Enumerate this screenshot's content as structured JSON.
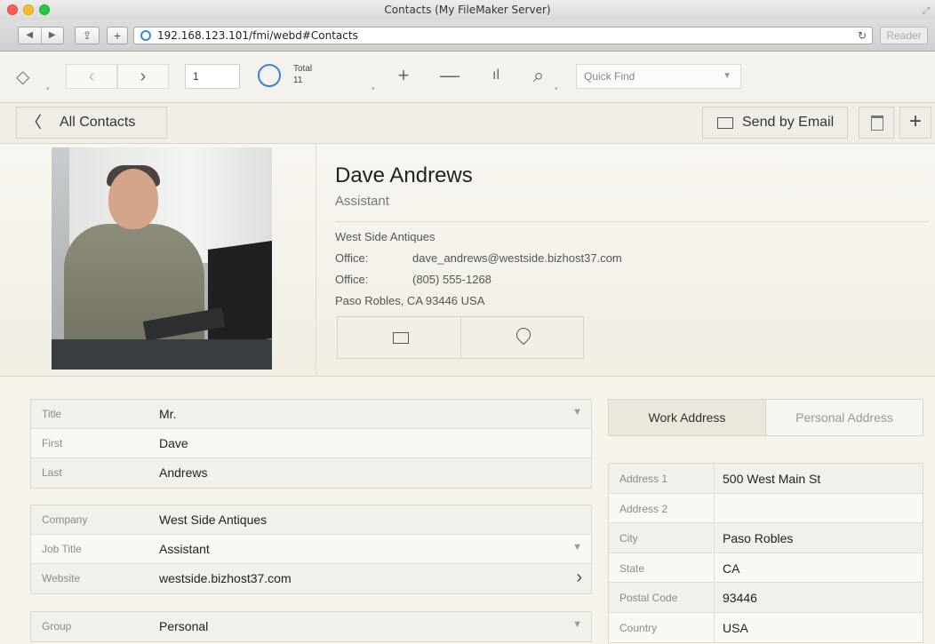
{
  "browser": {
    "window_title": "Contacts (My FileMaker Server)",
    "url": "192.168.123.101/fmi/webd#Contacts",
    "reader_label": "Reader"
  },
  "toolbar": {
    "record_number": "1",
    "total_label": "Total",
    "total_count": "11",
    "quick_find_placeholder": "Quick Find"
  },
  "header": {
    "back_label": "All Contacts",
    "send_email_label": "Send by Email"
  },
  "card": {
    "name": "Dave Andrews",
    "job_title": "Assistant",
    "company": "West Side Antiques",
    "office_label_1": "Office:",
    "email": "dave_andrews@westside.bizhost37.com",
    "office_label_2": "Office:",
    "phone": "(805) 555-1268",
    "city_state": "Paso Robles, CA 93446 USA"
  },
  "fields": {
    "group1": [
      {
        "label": "Title",
        "value": "Mr."
      },
      {
        "label": "First",
        "value": "Dave"
      },
      {
        "label": "Last",
        "value": "Andrews"
      }
    ],
    "group2": [
      {
        "label": "Company",
        "value": "West Side Antiques"
      },
      {
        "label": "Job Title",
        "value": "Assistant"
      },
      {
        "label": "Website",
        "value": "westside.bizhost37.com"
      }
    ],
    "group3": [
      {
        "label": "Group",
        "value": "Personal"
      }
    ]
  },
  "address": {
    "tabs": [
      "Work Address",
      "Personal Address"
    ],
    "rows": [
      {
        "label": "Address 1",
        "value": "500 West Main St"
      },
      {
        "label": "Address 2",
        "value": ""
      },
      {
        "label": "City",
        "value": "Paso Robles"
      },
      {
        "label": "State",
        "value": "CA"
      },
      {
        "label": "Postal Code",
        "value": "93446"
      },
      {
        "label": "Country",
        "value": "USA"
      }
    ]
  }
}
